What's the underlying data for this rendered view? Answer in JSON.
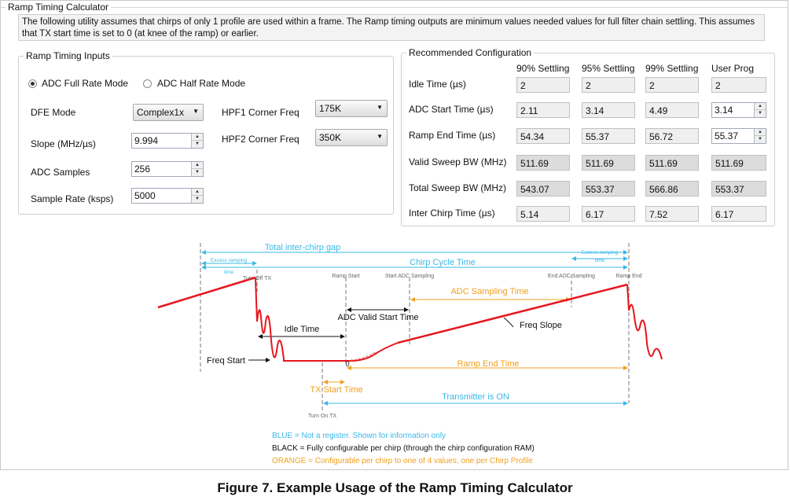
{
  "window": {
    "title": "Ramp Timing Calculator"
  },
  "note": "The following utility assumes that chirps of only 1 profile are used within a frame.  The Ramp timing outputs are minimum values needed values for full filter chain settling. This assumes that TX start time is set to 0 (at knee of the ramp) or earlier.",
  "inputs": {
    "title": "Ramp Timing Inputs",
    "radio_full": "ADC Full Rate Mode",
    "radio_half": "ADC Half Rate Mode",
    "selected_mode": "full",
    "dfe_label": "DFE Mode",
    "dfe_value": "Complex1x",
    "slope_label": "Slope (MHz/µs)",
    "slope_value": "9.994",
    "adc_samples_label": "ADC Samples",
    "adc_samples_value": "256",
    "sample_rate_label": "Sample Rate (ksps)",
    "sample_rate_value": "5000",
    "hpf1_label": "HPF1 Corner Freq",
    "hpf1_value": "175K",
    "hpf2_label": "HPF2 Corner Freq",
    "hpf2_value": "350K"
  },
  "recommended": {
    "title": "Recommended Configuration",
    "columns": [
      "90% Settling",
      "95% Settling",
      "99% Settling",
      "User Prog"
    ],
    "rows": [
      {
        "label": "Idle Time  (µs)",
        "values": [
          "2",
          "2",
          "2",
          "2"
        ],
        "editable": false
      },
      {
        "label": "ADC Start Time (µs)",
        "values": [
          "2.11",
          "3.14",
          "4.49",
          "3.14"
        ],
        "editable": true
      },
      {
        "label": "Ramp End Time (µs)",
        "values": [
          "54.34",
          "55.37",
          "56.72",
          "55.37"
        ],
        "editable": true
      },
      {
        "label": "Valid Sweep BW (MHz)",
        "values": [
          "511.69",
          "511.69",
          "511.69",
          "511.69"
        ],
        "editable": false
      },
      {
        "label": "Total Sweep BW (MHz)",
        "values": [
          "543.07",
          "553.37",
          "566.86",
          "553.37"
        ],
        "editable": false
      },
      {
        "label": "Inter Chirp Time (µs)",
        "values": [
          "5.14",
          "6.17",
          "7.52",
          "6.17"
        ],
        "editable": false
      }
    ]
  },
  "diagram": {
    "total_gap": "Total inter-chirp gap",
    "excess_ramping": "Excess ramping",
    "time_word": "time",
    "chirp_cycle": "Chirp Cycle Time",
    "turn_off_tx": "Turn Off TX",
    "ramp_start": "Ramp Start",
    "start_adc": "Start ADC Sampling",
    "end_adc": "End ADC Sampling",
    "ramp_end": "Ramp End",
    "adc_sampling_time": "ADC Sampling Time",
    "adc_valid_start": "ADC Valid Start Time",
    "freq_slope": "Freq Slope",
    "idle_time": "Idle Time",
    "freq_start": "Freq Start",
    "zero": "0",
    "ramp_end_time": "Ramp End Time",
    "tx_start_time": "TX Start Time",
    "transmitter_on": "Transmitter is ON",
    "turn_on_tx": "Turn On TX",
    "legend_blue": "BLUE = Not a register. Shown for information only",
    "legend_black": "BLACK = Fully configurable per chirp (through the chirp configuration RAM)",
    "legend_orange": "ORANGE = Configurable per chirp to one of 4 values, one per Chirp Profile",
    "colors": {
      "blue": "#3ab8e8",
      "orange": "#f0a020",
      "red": "#e8141c",
      "black": "#111111"
    }
  },
  "caption": "Figure 7. Example Usage of the Ramp Timing Calculator"
}
